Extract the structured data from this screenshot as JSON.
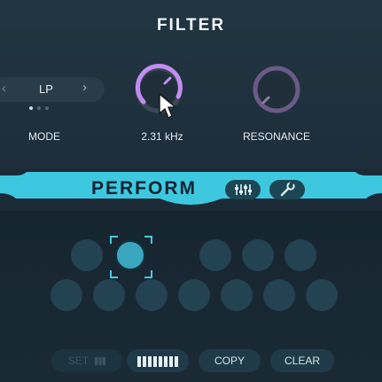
{
  "filter": {
    "title": "FILTER",
    "mode": {
      "value": "LP",
      "label": "MODE",
      "prev_icon": "chevron-left-icon",
      "next_icon": "chevron-right-icon",
      "page_count": 3,
      "page_index": 1
    },
    "cutoff": {
      "value_text": "2.31 kHz",
      "level": 0.72
    },
    "resonance": {
      "label": "RESONANCE",
      "level": 0.05
    }
  },
  "perform": {
    "title": "PERFORM",
    "sliders_icon": "sliders-icon",
    "wrench_icon": "wrench-icon",
    "selected_pad": 2
  },
  "buttons": {
    "set": "SET",
    "set_icon": "piano-keys-icon",
    "keys_icon": "piano-keys-icon",
    "copy": "COPY",
    "clear": "CLEAR"
  },
  "colors": {
    "accent": "#3ec8e0",
    "knob_active": "#c38cf0",
    "knob_inactive": "#6b5a86",
    "pad": "#234252",
    "pad_selected": "#3aa7bf"
  }
}
